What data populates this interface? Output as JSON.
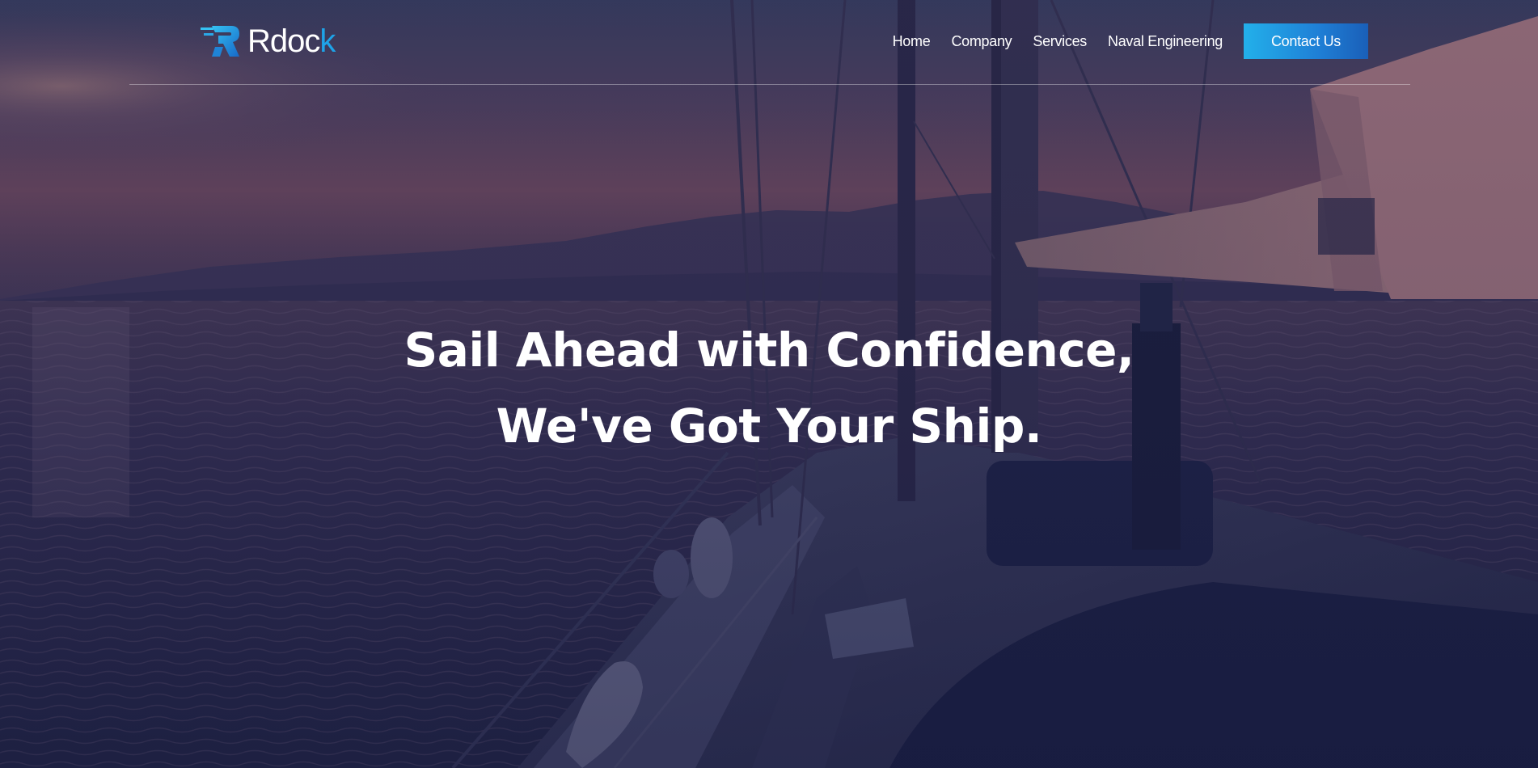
{
  "header": {
    "logo_text_main": "Rdoc",
    "logo_text_accent": "k",
    "nav": [
      {
        "label": "Home"
      },
      {
        "label": "Company"
      },
      {
        "label": "Services"
      },
      {
        "label": "Naval Engineering"
      }
    ],
    "contact_label": "Contact Us"
  },
  "hero": {
    "headline_line1": "Sail Ahead with Confidence,",
    "headline_line2": "We've Got Your Ship."
  },
  "colors": {
    "accent": "#1ea3e8",
    "button_gradient_start": "#23b0ea",
    "button_gradient_end": "#1a5fb8",
    "overlay": "#1e2240"
  },
  "icons": {
    "logo": "rdock-logo-icon"
  }
}
